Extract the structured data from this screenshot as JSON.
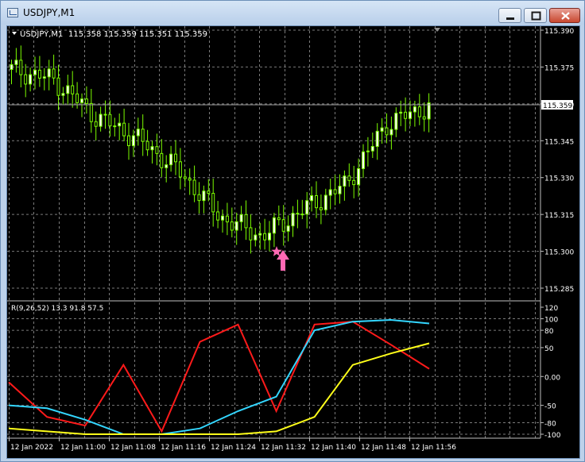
{
  "window": {
    "title": "USDJPY,M1",
    "buttons": {
      "minimize": "minimize",
      "maximize": "maximize",
      "close": "close"
    }
  },
  "main_chart": {
    "header_symbol": "USDJPY,M1",
    "header_ohlc": "115.358 115.359 115.351 115.359",
    "price_ticks": [
      "115.390",
      "115.375",
      "115.360",
      "115.345",
      "115.330",
      "115.315",
      "115.300",
      "115.285"
    ],
    "current_price_label": "115.359"
  },
  "indicator": {
    "label": "R(9,26,52) 13.3 91.8 57.5",
    "ticks": [
      "120",
      "100",
      "80",
      "50",
      "0.00",
      "-50",
      "-80",
      "-100"
    ]
  },
  "time_axis": {
    "labels": [
      "12 Jan 2022",
      "12 Jan 11:00",
      "12 Jan 11:08",
      "12 Jan 11:16",
      "12 Jan 11:24",
      "12 Jan 11:32",
      "12 Jan 11:40",
      "12 Jan 11:48",
      "12 Jan 11:56"
    ]
  },
  "colors": {
    "background": "#000000",
    "grid": "#7a7a7a",
    "candle": "#7cfc00",
    "candle_body": "#ffffff",
    "line_fast": "#ff1a1a",
    "line_mid": "#33d6ff",
    "line_slow": "#ffff1a",
    "signal": "#ff69b4"
  },
  "chart_data": [
    {
      "type": "line",
      "note": "candlestick price series (close values), USDJPY M1",
      "ylim": [
        115.28,
        115.392
      ],
      "x": [
        "12 Jan 2022",
        "12 Jan 11:00",
        "12 Jan 11:08",
        "12 Jan 11:16",
        "12 Jan 11:24",
        "12 Jan 11:32",
        "12 Jan 11:40",
        "12 Jan 11:48",
        "12 Jan 11:56"
      ],
      "series": [
        {
          "values": [
            115.374,
            115.37,
            115.355,
            115.346,
            115.333,
            115.314,
            115.306,
            115.317,
            115.327,
            115.352,
            115.359
          ]
        }
      ],
      "yticks": [
        "115.390",
        "115.375",
        "115.360",
        "115.345",
        "115.330",
        "115.315",
        "115.300",
        "115.285"
      ]
    },
    {
      "type": "line",
      "note": "R(9,26,52) oscillator",
      "ylim": [
        -100,
        120
      ],
      "x": [
        "12 Jan 2022",
        "12 Jan 11:00",
        "12 Jan 11:08",
        "12 Jan 11:16",
        "12 Jan 11:24",
        "12 Jan 11:32",
        "12 Jan 11:40",
        "12 Jan 11:48",
        "12 Jan 11:56"
      ],
      "series": [
        {
          "values": [
            -10,
            -70,
            -85,
            20,
            -95,
            60,
            90,
            -60,
            90,
            95,
            55,
            13.3
          ]
        },
        {
          "values": [
            -50,
            -55,
            -75,
            -100,
            -100,
            -90,
            -60,
            -35,
            80,
            95,
            98,
            91.8
          ]
        },
        {
          "values": [
            -90,
            -95,
            -100,
            -100,
            -100,
            -100,
            -100,
            -95,
            -70,
            20,
            40,
            57.5
          ]
        }
      ],
      "yticks": [
        "120",
        "100",
        "80",
        "50",
        "0.00",
        "-50",
        "-80",
        "-100"
      ]
    }
  ]
}
